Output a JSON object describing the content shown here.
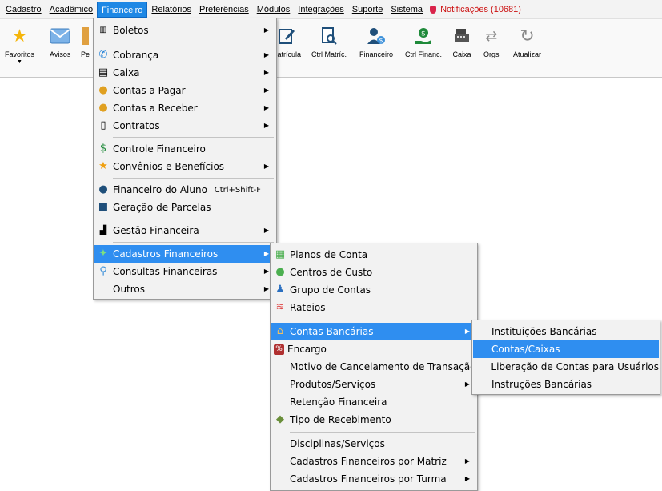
{
  "menubar": {
    "items": [
      "Cadastro",
      "Acadêmico",
      "Financeiro",
      "Relatórios",
      "Preferências",
      "Módulos",
      "Integrações",
      "Suporte",
      "Sistema"
    ],
    "notifications": "Notificações (10681)"
  },
  "toolbar": {
    "favoritos": "Favoritos",
    "avisos": "Avisos",
    "pe": "Pe",
    "matricula": "Matrícula",
    "ctrl_matric": "Ctrl Matríc.",
    "financeiro": "Financeiro",
    "ctrl_financ": "Ctrl Financ.",
    "caixa": "Caixa",
    "orgs": "Orgs",
    "atualizar": "Atualizar"
  },
  "menu_financeiro": {
    "boletos": "Boletos",
    "cobranca": "Cobrança",
    "caixa": "Caixa",
    "contas_pagar": "Contas a Pagar",
    "contas_receber": "Contas a Receber",
    "contratos": "Contratos",
    "controle_financeiro": "Controle Financeiro",
    "convenios": "Convênios e Benefícios",
    "financeiro_aluno": "Financeiro do Aluno",
    "financeiro_aluno_shortcut": "Ctrl+Shift-F",
    "geracao_parcelas": "Geração de Parcelas",
    "gestao_financeira": "Gestão Financeira",
    "cadastros_financeiros": "Cadastros Financeiros",
    "consultas_financeiras": "Consultas Financeiras",
    "outros": "Outros"
  },
  "menu_cadastros": {
    "planos_conta": "Planos de Conta",
    "centros_custo": "Centros de Custo",
    "grupo_contas": "Grupo de Contas",
    "rateios": "Rateios",
    "contas_bancarias": "Contas Bancárias",
    "encargo": "Encargo",
    "motivo_cancelamento": "Motivo de Cancelamento de Transação",
    "produtos_servicos": "Produtos/Serviços",
    "retencao": "Retenção Financeira",
    "tipo_recebimento": "Tipo de Recebimento",
    "disciplinas_servicos": "Disciplinas/Serviços",
    "por_matriz": "Cadastros Financeiros por Matriz",
    "por_turma": "Cadastros Financeiros por Turma"
  },
  "menu_contas_bancarias": {
    "instituicoes": "Instituições Bancárias",
    "contas_caixas": "Contas/Caixas",
    "liberacao": "Liberação de Contas para Usuários",
    "instrucoes": "Instruções Bancárias"
  },
  "colors": {
    "highlight": "#2f8ef0",
    "menubar_active": "#1e88e5",
    "notification_text": "#cc1111"
  }
}
